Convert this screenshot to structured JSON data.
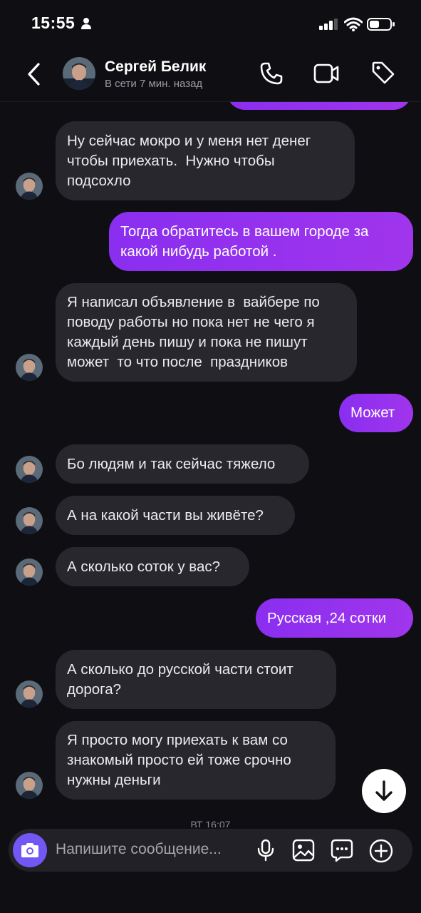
{
  "status_bar": {
    "time": "15:55"
  },
  "header": {
    "name": "Сергей Белик",
    "presence": "В сети 7 мин. назад"
  },
  "messages": [
    {
      "from": "them",
      "text": "Ну сейчас мокро и у меня нет денег\nчтобы приехать.  Нужно чтобы\nподсохло"
    },
    {
      "from": "me",
      "text": "Тогда обратитесь в вашем городе за\nкакой нибудь работой ."
    },
    {
      "from": "them",
      "text": "Я написал объявление в  вайбере по\nповоду работы но пока нет не чего я\nкаждый день пишу и пока не пишут\nможет  то что после  праздников"
    },
    {
      "from": "me",
      "text": "Может"
    },
    {
      "from": "them",
      "text": "Бо людям и так сейчас тяжело"
    },
    {
      "from": "them",
      "text": "А на какой части вы живёте?"
    },
    {
      "from": "them",
      "text": "А сколько соток у вас?"
    },
    {
      "from": "me",
      "text": "Русская ,24 сотки"
    },
    {
      "from": "them",
      "text": "А сколько до русской части стоит\nдорога?"
    },
    {
      "from": "them",
      "text": "Я просто могу приехать к вам со\nзнакомый просто ей тоже срочно\nнужны деньги"
    }
  ],
  "date_separator": "ВТ 16:07",
  "composer": {
    "placeholder": "Напишите сообщение..."
  },
  "colors": {
    "outgoing": "#9431ee",
    "incoming": "#27272d",
    "camera_button": "#7257f4"
  },
  "icons": [
    "back-icon",
    "phone-icon",
    "video-icon",
    "tag-icon",
    "arrow-down-icon",
    "camera-icon",
    "microphone-icon",
    "image-icon",
    "sticker-icon",
    "plus-icon"
  ]
}
